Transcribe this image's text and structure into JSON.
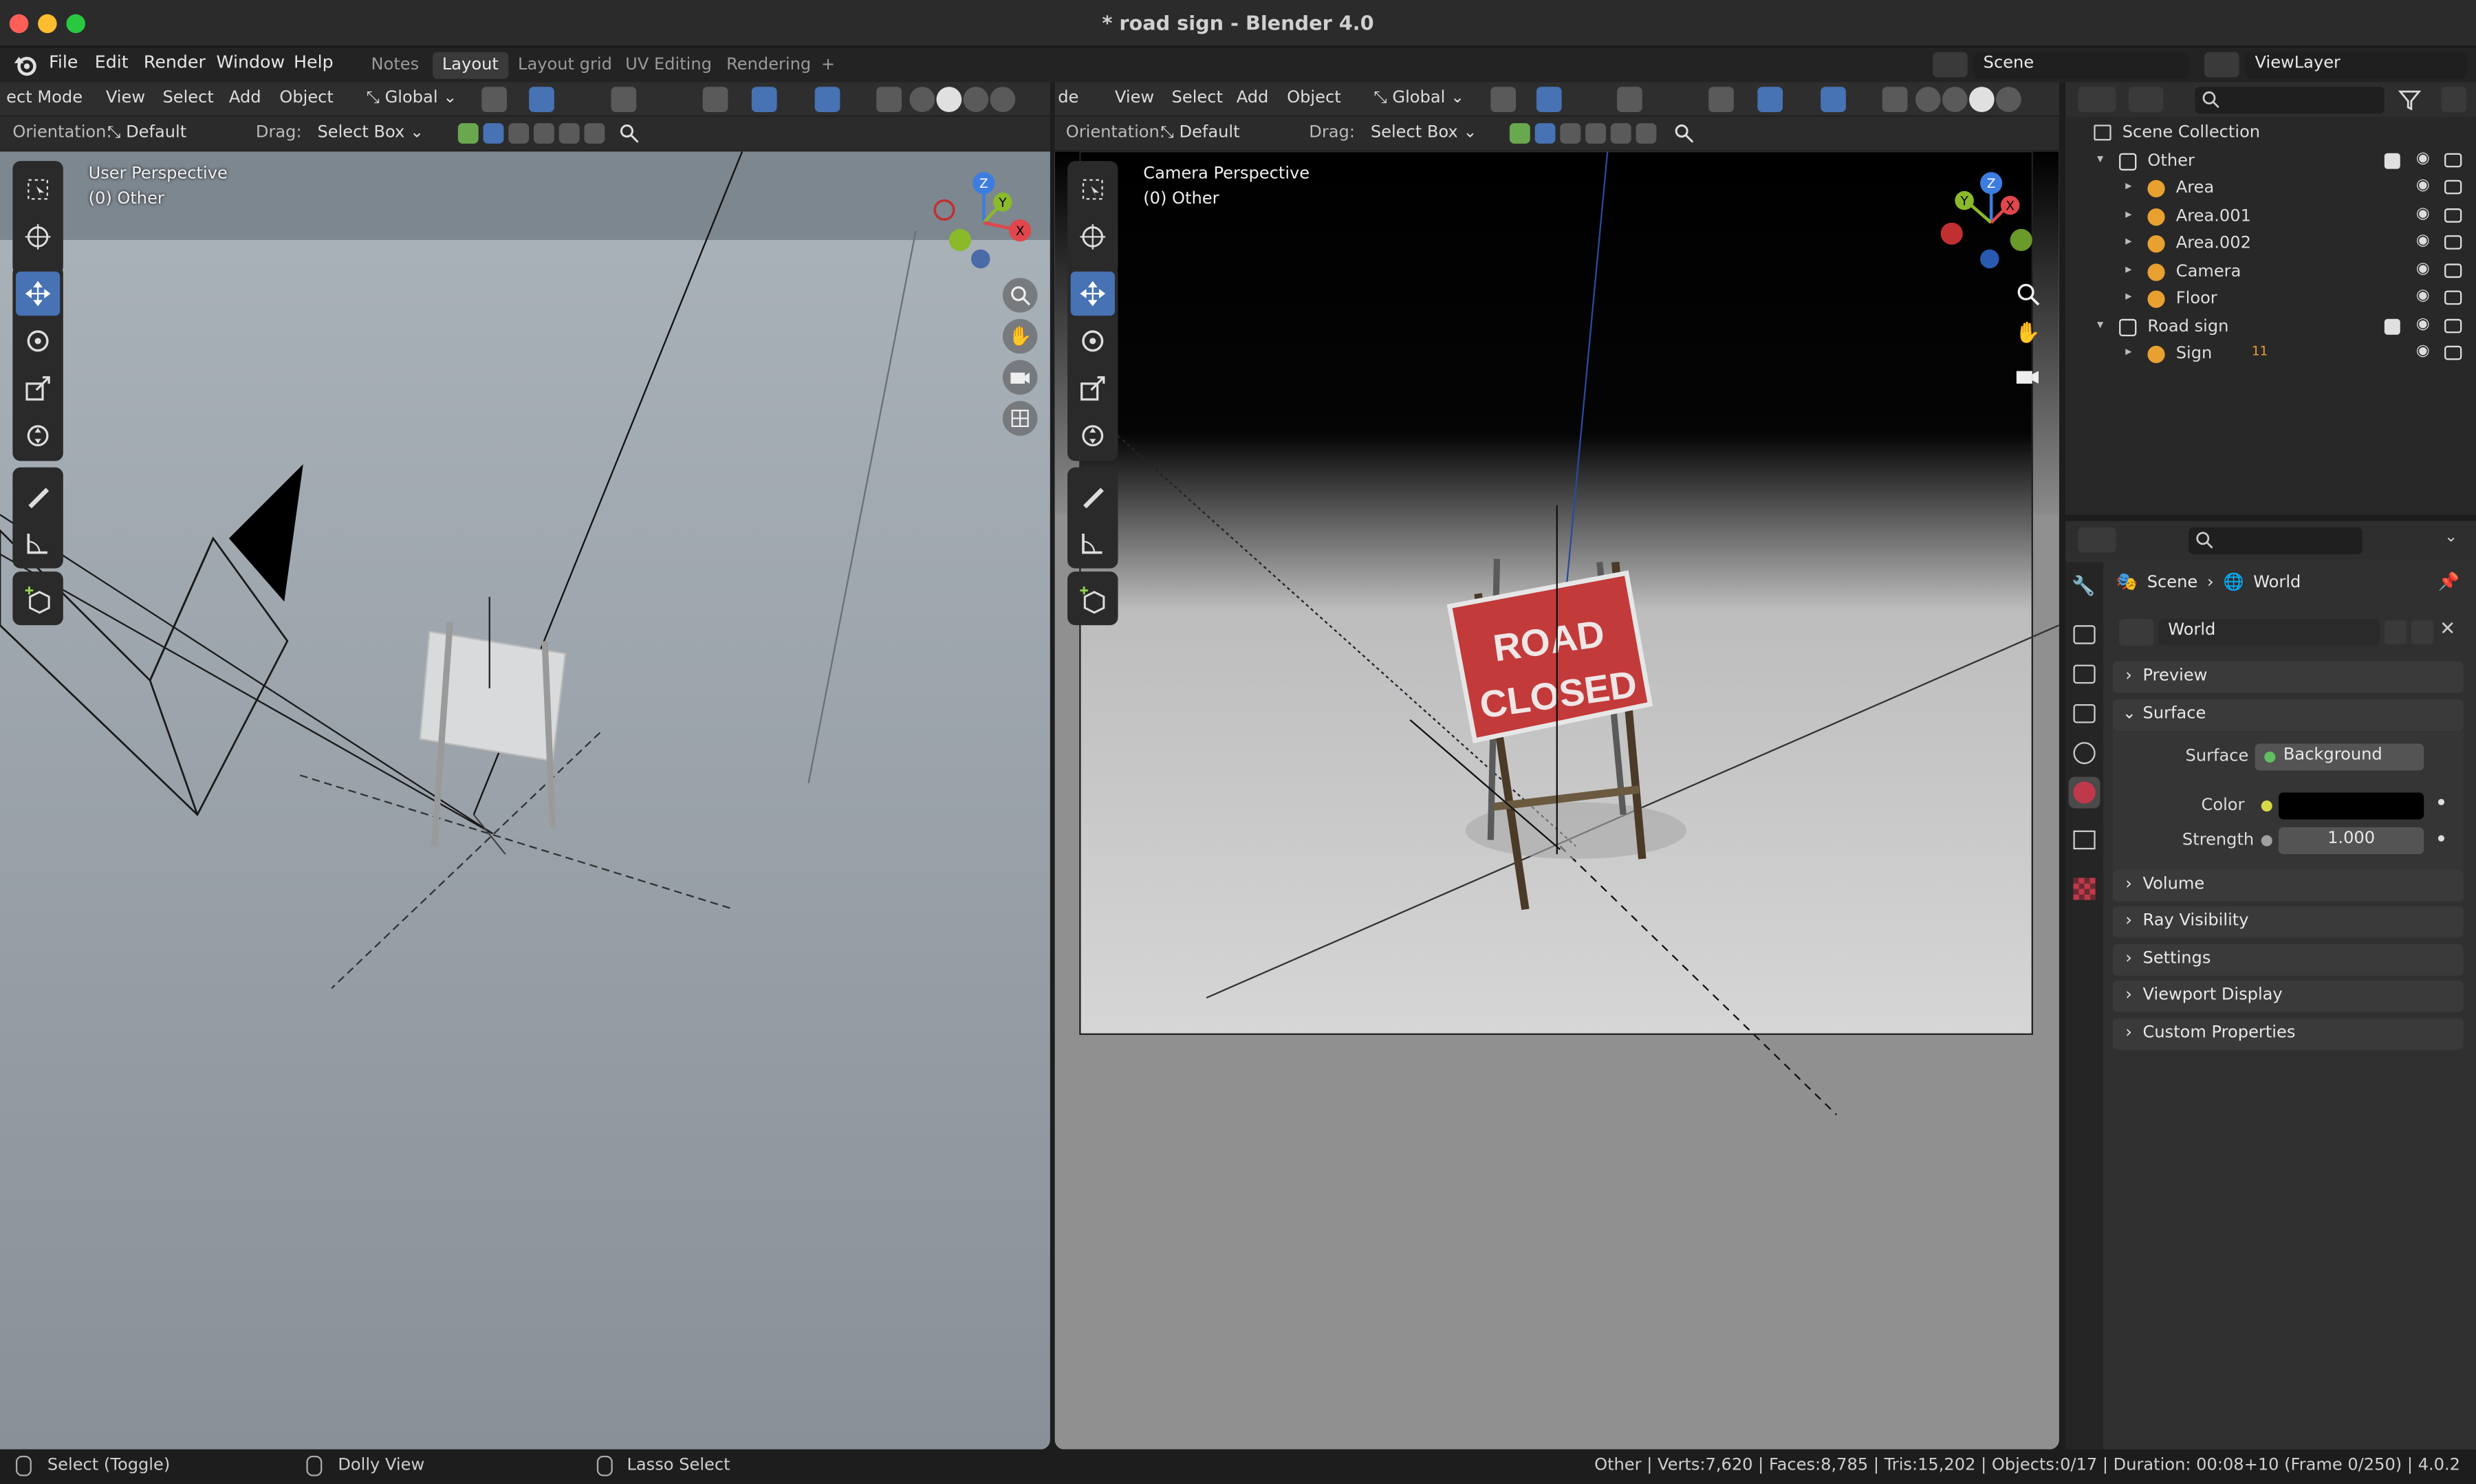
{
  "window": {
    "title": "* road sign - Blender 4.0"
  },
  "menu": {
    "items": [
      "File",
      "Edit",
      "Render",
      "Window",
      "Help"
    ]
  },
  "workspaces": {
    "tabs": [
      "Notes",
      "Layout",
      "Layout grid",
      "UV Editing",
      "Rendering"
    ],
    "add": "+",
    "active": "Layout"
  },
  "topright": {
    "scene": "Scene",
    "view_layer": "ViewLayer"
  },
  "left_header": {
    "mode": "ect Mode",
    "view": "View",
    "select": "Select",
    "add": "Add",
    "object": "Object",
    "transform": "Global"
  },
  "left_subheader": {
    "orientation_label": "Orientation:",
    "orientation": "Default",
    "drag_label": "Drag:",
    "drag": "Select Box"
  },
  "right_header": {
    "mode": "de",
    "view": "View",
    "select": "Select",
    "add": "Add",
    "object": "Object",
    "transform": "Global"
  },
  "right_subheader": {
    "orientation_label": "Orientation:",
    "orientation": "Default",
    "drag_label": "Drag:",
    "drag": "Select Box"
  },
  "left_viewport": {
    "perspective": "User Perspective",
    "collection": "(0) Other"
  },
  "right_viewport": {
    "perspective": "Camera Perspective",
    "collection": "(0) Other",
    "sign_line1": "ROAD",
    "sign_line2": "CLOSED"
  },
  "gizmo": {
    "x": "X",
    "y": "Y",
    "z": "Z"
  },
  "outliner": {
    "root": "Scene Collection",
    "rows": [
      {
        "label": "Other",
        "indent": 0,
        "type": "collection"
      },
      {
        "label": "Area",
        "indent": 1,
        "type": "light"
      },
      {
        "label": "Area.001",
        "indent": 1,
        "type": "light"
      },
      {
        "label": "Area.002",
        "indent": 1,
        "type": "light"
      },
      {
        "label": "Camera",
        "indent": 1,
        "type": "camera"
      },
      {
        "label": "Floor",
        "indent": 1,
        "type": "mesh"
      },
      {
        "label": "Road sign",
        "indent": 0,
        "type": "collection"
      },
      {
        "label": "Sign",
        "indent": 1,
        "type": "armature",
        "badge": "11"
      }
    ]
  },
  "properties": {
    "breadcrumb_scene": "Scene",
    "breadcrumb_world": "World",
    "world_name": "World",
    "panels": {
      "preview": "Preview",
      "surface": "Surface",
      "volume": "Volume",
      "ray_visibility": "Ray Visibility",
      "settings": "Settings",
      "viewport_display": "Viewport Display",
      "custom_properties": "Custom Properties"
    },
    "surface_label": "Surface",
    "surface_value": "Background",
    "color_label": "Color",
    "color_value": "#000000",
    "strength_label": "Strength",
    "strength_value": "1.000"
  },
  "statusbar": {
    "select": "Select (Toggle)",
    "dolly": "Dolly View",
    "lasso": "Lasso Select",
    "stats": "Other | Verts:7,620 | Faces:8,785 | Tris:15,202 | Objects:0/17 | Duration: 00:08+10 (Frame 0/250) | 4.0.2"
  },
  "colors": {
    "accent": "#4772b3",
    "sign_red": "#c23a3a",
    "gizmo_x": "#e0464c",
    "gizmo_y": "#8ab92a",
    "gizmo_z": "#3d7de0"
  }
}
